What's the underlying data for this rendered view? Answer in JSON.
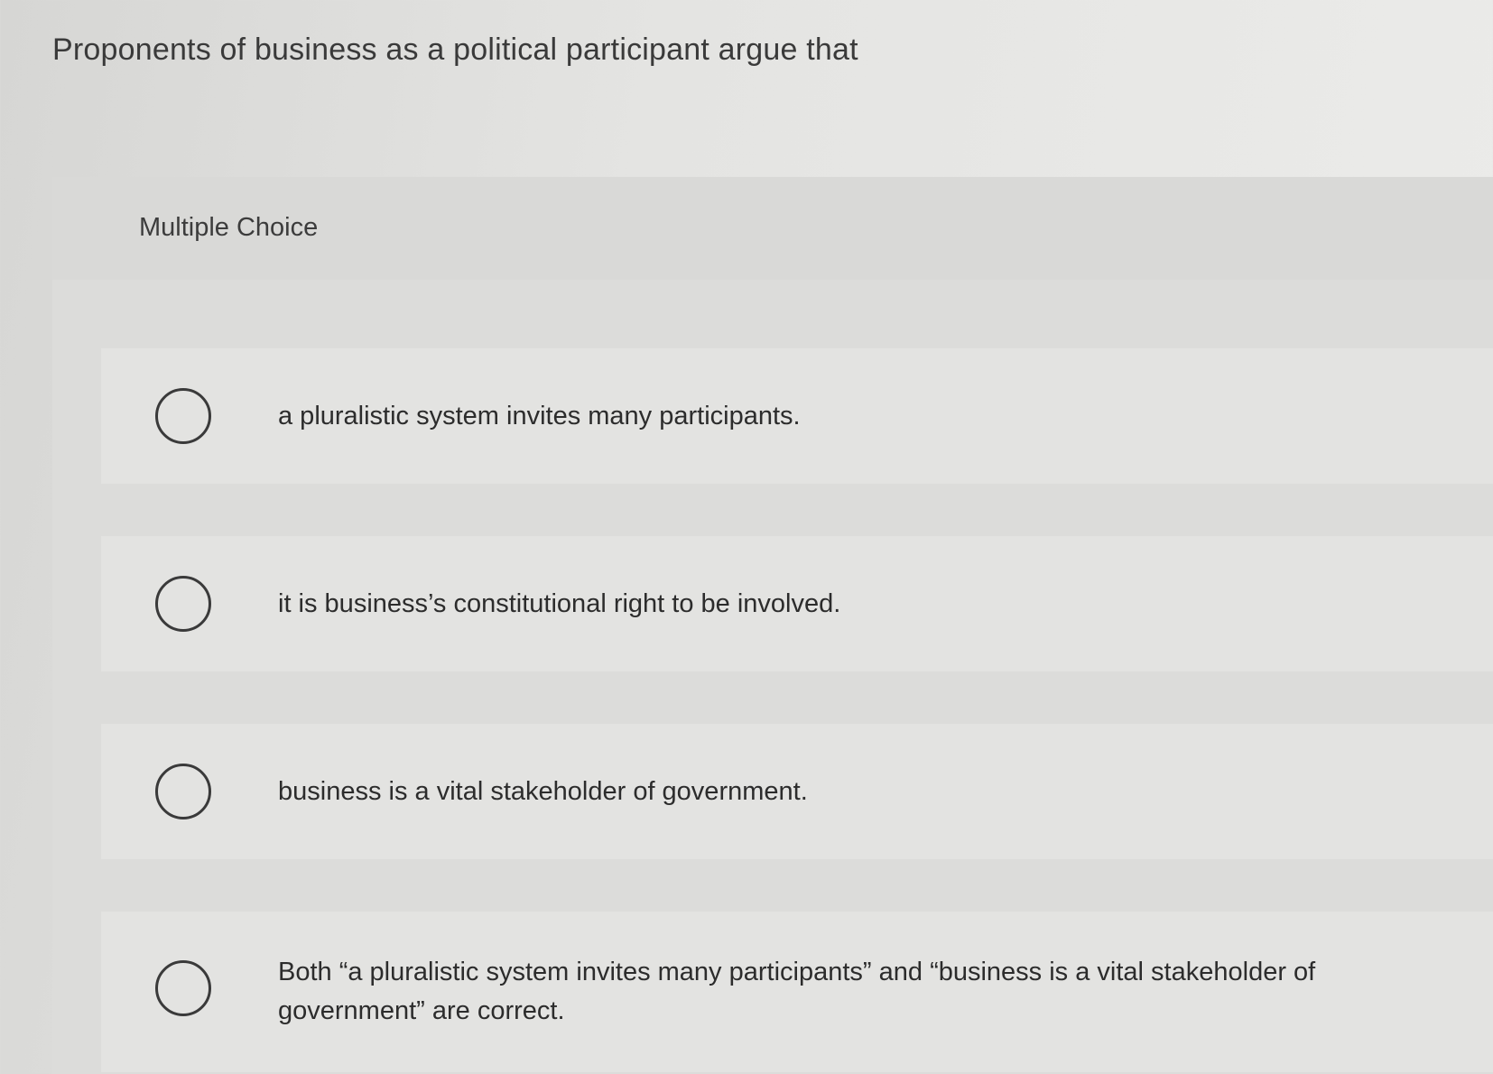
{
  "question": {
    "text": "Proponents of business as a political participant argue that"
  },
  "panel": {
    "label": "Multiple Choice"
  },
  "options": [
    {
      "text": "a pluralistic system invites many participants."
    },
    {
      "text": "it is business’s constitutional right to be involved."
    },
    {
      "text": "business is a vital stakeholder of government."
    },
    {
      "text": "Both “a pluralistic system invites many participants” and “business is a vital stakeholder of government” are correct."
    }
  ],
  "icons": {
    "radio": "radio-unchecked-icon"
  }
}
